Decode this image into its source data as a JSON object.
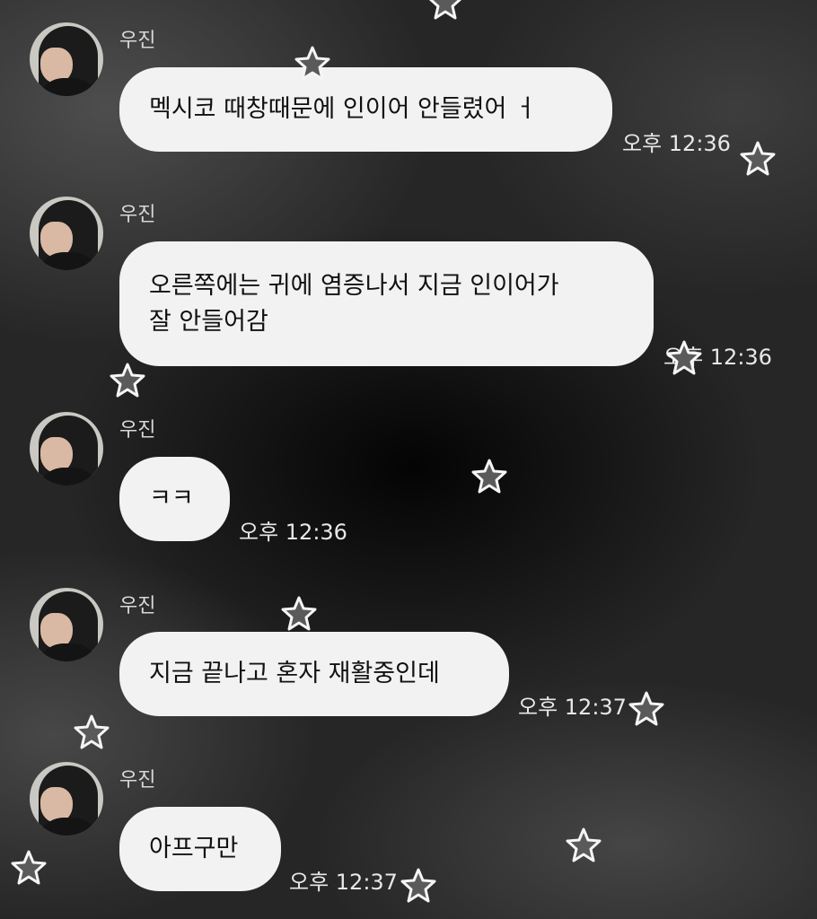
{
  "messages": [
    {
      "sender": "우진",
      "text": "멕시코 때창때문에 인이어 안들렸어 ㅓ",
      "time": "오후 12:36"
    },
    {
      "sender": "우진",
      "text": "오른쪽에는 귀에 염증나서 지금 인이어가\n잘 안들어감",
      "time": "오후 12:36"
    },
    {
      "sender": "우진",
      "text": "ㅋㅋ",
      "time": "오후 12:36"
    },
    {
      "sender": "우진",
      "text": "지금 끝나고 혼자 재활중인데",
      "time": "오후 12:37"
    },
    {
      "sender": "우진",
      "text": "아프구만",
      "time": "오후 12:37"
    }
  ],
  "decor": {
    "icon": "star-sticker-icon",
    "star_fill": "#5a5a5a",
    "star_outline": "#f5f5f5"
  }
}
